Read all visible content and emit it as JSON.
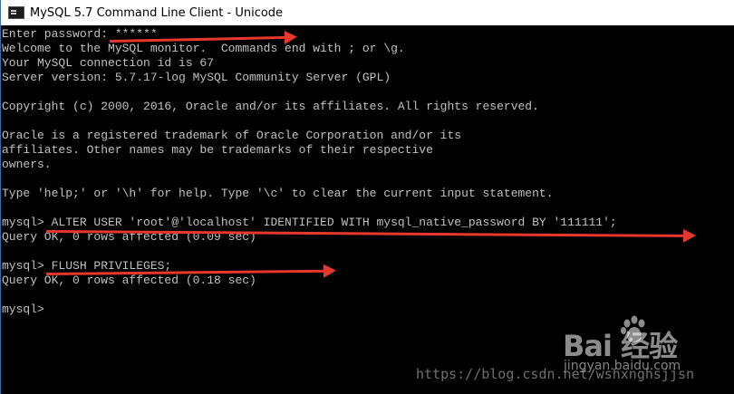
{
  "window": {
    "title": "MySQL 5.7 Command Line Client - Unicode"
  },
  "console": {
    "lines": [
      "Enter password: ******",
      "Welcome to the MySQL monitor.  Commands end with ; or \\g.",
      "Your MySQL connection id is 67",
      "Server version: 5.7.17-log MySQL Community Server (GPL)",
      "",
      "Copyright (c) 2000, 2016, Oracle and/or its affiliates. All rights reserved.",
      "",
      "Oracle is a registered trademark of Oracle Corporation and/or its",
      "affiliates. Other names may be trademarks of their respective",
      "owners.",
      "",
      "Type 'help;' or '\\h' for help. Type '\\c' to clear the current input statement.",
      "",
      "mysql> ALTER USER 'root'@'localhost' IDENTIFIED WITH mysql_native_password BY '111111';",
      "Query OK, 0 rows affected (0.09 sec)",
      "",
      "mysql> FLUSH PRIVILEGES;",
      "Query OK, 0 rows affected (0.18 sec)",
      "",
      "mysql>"
    ]
  },
  "watermark": {
    "url": "https://blog.csdn.net/wshxnghsjjsn",
    "site": "jingyan.baidu.com",
    "logo": "Bai  经验"
  },
  "colors": {
    "console_text": "#c0c0c0",
    "console_bg": "#000000",
    "arrow": "#e8372d"
  }
}
